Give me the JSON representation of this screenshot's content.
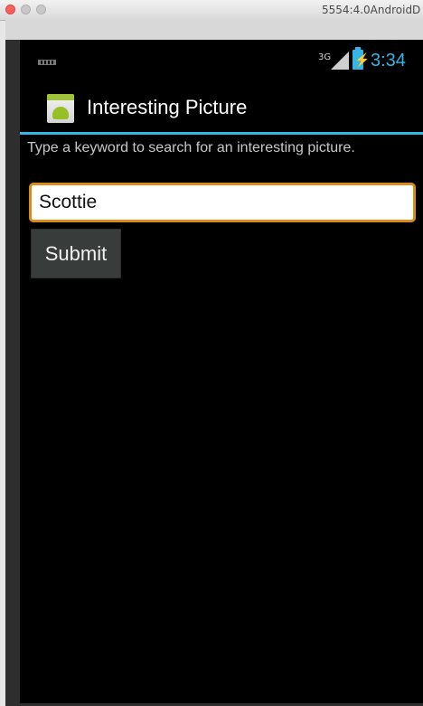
{
  "window": {
    "title": "5554:4.0AndroidD"
  },
  "status_bar": {
    "network_label": "3G",
    "clock": "3:34",
    "icons": [
      "keyboard-icon",
      "signal-icon",
      "battery-charging-icon"
    ]
  },
  "action_bar": {
    "title": "Interesting Picture",
    "icon": "android-app-icon",
    "accent_color": "#33b5e5"
  },
  "form": {
    "prompt": "Type a keyword to search for an interesting picture.",
    "keyword_value": "Scottie",
    "submit_label": "Submit",
    "input_focus_color": "#d98c1a"
  }
}
